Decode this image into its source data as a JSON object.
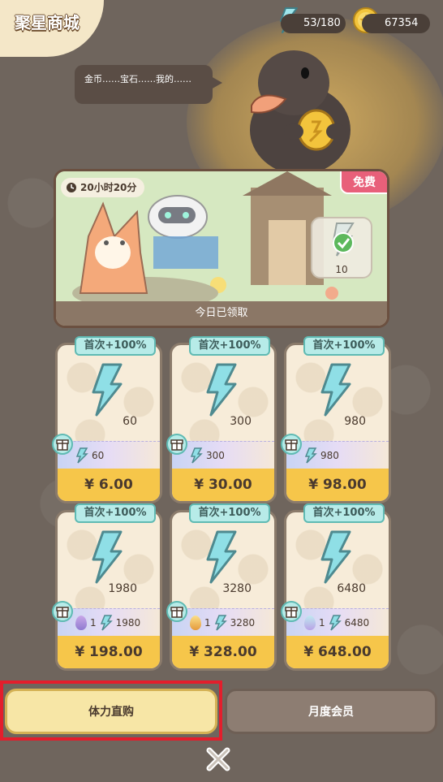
{
  "header": {
    "title": "聚星商城",
    "energy": "53/180",
    "coins": "67354"
  },
  "npc": {
    "speech": "金币……宝石……我的……"
  },
  "banner": {
    "timer": "20小时20分",
    "free_tag": "免费",
    "reward_count": "10",
    "status": "今日已领取"
  },
  "packs": [
    {
      "badge": "首次+100%",
      "amount": "60",
      "bonus_energy": "60",
      "egg": "",
      "price": "¥ 6.00"
    },
    {
      "badge": "首次+100%",
      "amount": "300",
      "bonus_energy": "300",
      "egg": "",
      "price": "¥ 30.00"
    },
    {
      "badge": "首次+100%",
      "amount": "980",
      "bonus_energy": "980",
      "egg": "",
      "price": "¥ 98.00"
    },
    {
      "badge": "首次+100%",
      "amount": "1980",
      "bonus_energy": "1980",
      "egg": "1",
      "price": "¥ 198.00"
    },
    {
      "badge": "首次+100%",
      "amount": "3280",
      "bonus_energy": "3280",
      "egg": "1",
      "price": "¥ 328.00"
    },
    {
      "badge": "首次+100%",
      "amount": "6480",
      "bonus_energy": "6480",
      "egg": "1",
      "price": "¥ 648.00"
    }
  ],
  "tabs": {
    "energy_purchase": "体力直购",
    "monthly_member": "月度会员"
  },
  "colors": {
    "background": "#6f655d",
    "price_bar": "#f6c64a",
    "badge": "#b7ebe8",
    "highlight_frame": "#e31e2c"
  }
}
